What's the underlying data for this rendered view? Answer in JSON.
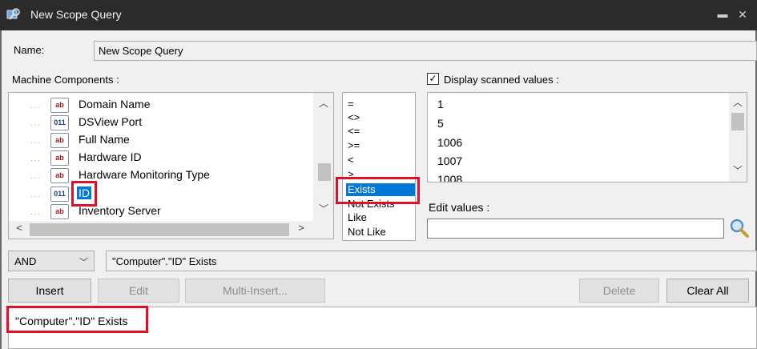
{
  "window": {
    "title": "New Scope Query",
    "minimize_glyph": "▬",
    "close_glyph": "✕"
  },
  "name": {
    "label": "Name:",
    "value": "New Scope Query"
  },
  "machine_components": {
    "label": "Machine Components :",
    "items": [
      {
        "icon": "text-field-icon",
        "icon_text": "ab",
        "label": "Domain Name"
      },
      {
        "icon": "numeric-field-icon",
        "icon_text": "011",
        "label": "DSView Port"
      },
      {
        "icon": "text-field-icon",
        "icon_text": "ab",
        "label": "Full Name"
      },
      {
        "icon": "text-field-icon",
        "icon_text": "ab",
        "label": "Hardware ID"
      },
      {
        "icon": "text-field-icon",
        "icon_text": "ab",
        "label": "Hardware Monitoring Type"
      },
      {
        "icon": "numeric-field-icon",
        "icon_text": "011",
        "label": "ID",
        "selected": true
      },
      {
        "icon": "text-field-icon",
        "icon_text": "ab",
        "label": "Inventory Server"
      }
    ]
  },
  "operators": {
    "items": [
      "=",
      "<>",
      "<=",
      ">=",
      "<",
      ">",
      "Exists",
      "Not Exists",
      "Like",
      "Not Like"
    ],
    "selected": "Exists"
  },
  "scanned_values": {
    "checkbox_label": "Display scanned values :",
    "checked": true,
    "items": [
      "1",
      "5",
      "1006",
      "1007",
      "1008"
    ]
  },
  "edit_values": {
    "label": "Edit values :",
    "value": ""
  },
  "logic": {
    "selected": "AND"
  },
  "expression": {
    "value": "\"Computer\".\"ID\"  Exists"
  },
  "buttons": {
    "insert": "Insert",
    "edit": "Edit",
    "multi_insert": "Multi-Insert...",
    "delete": "Delete",
    "clear_all": "Clear All"
  },
  "query": {
    "text": "\"Computer\".\"ID\"  Exists"
  },
  "colors": {
    "titlebar": "#2b2b2b",
    "selection": "#0078d7",
    "highlight": "#e0102a"
  }
}
